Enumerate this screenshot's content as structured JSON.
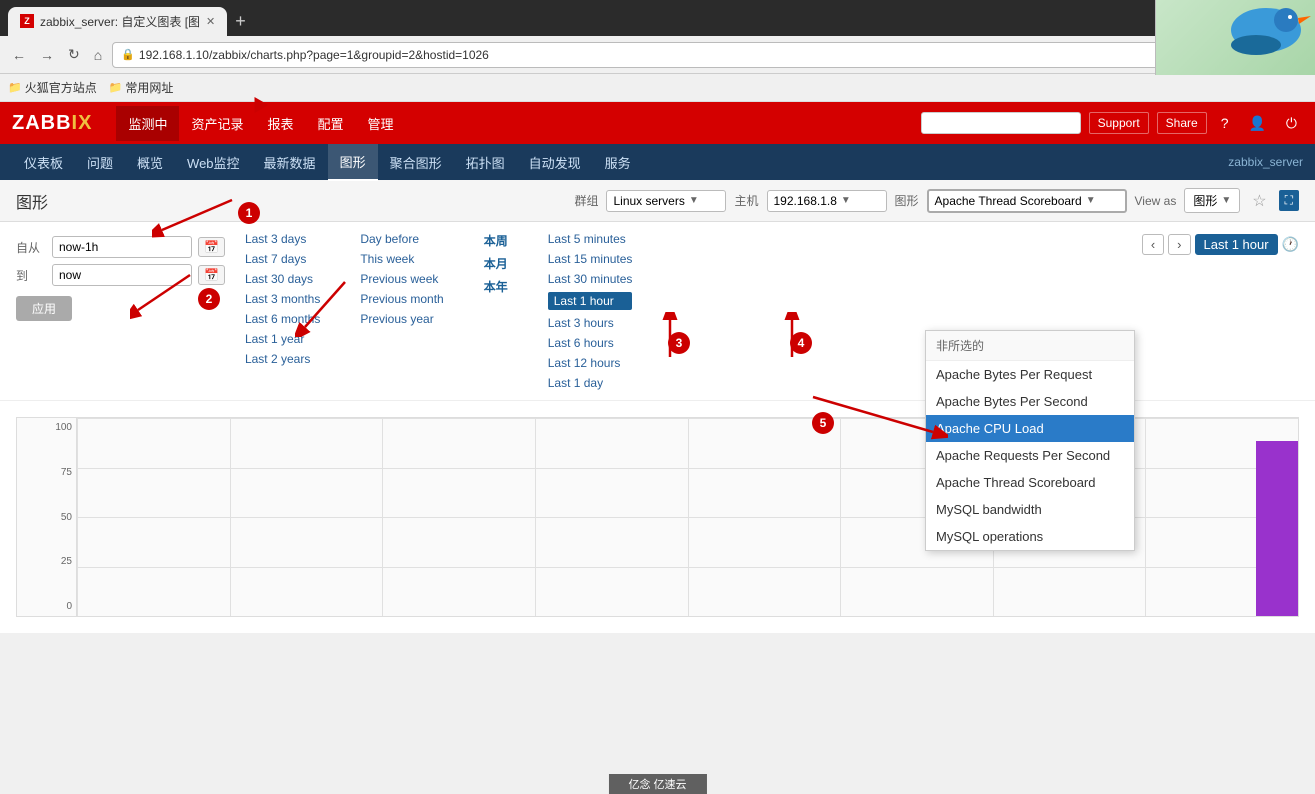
{
  "browser": {
    "tab_title": "zabbix_server: 自定义图表 [图",
    "tab_favicon": "Z",
    "url": "192.168.1.10/zabbix/charts.php?page=1&groupid=2&hostid=1026",
    "bookmark1_label": "火狐官方站点",
    "bookmark2_label": "常用网址",
    "new_tab_label": "+"
  },
  "zabbix": {
    "logo": "ZABBIX",
    "nav": {
      "monitoring": "监测中",
      "assets": "资产记录",
      "reports": "报表",
      "config": "配置",
      "admin": "管理"
    },
    "sub_nav": {
      "dashboard": "仪表板",
      "problems": "问题",
      "overview": "概览",
      "web": "Web监控",
      "latest": "最新数据",
      "graphs": "图形",
      "screens": "聚合图形",
      "maps": "拓扑图",
      "discovery": "自动发现",
      "services": "服务"
    },
    "sub_nav_right": "zabbix_server",
    "header_buttons": {
      "support": "Support",
      "share": "Share"
    }
  },
  "page": {
    "title": "图形",
    "group_label": "群组",
    "host_label": "主机",
    "graph_label": "图形",
    "view_as_label": "View as",
    "group_value": "Linux servers",
    "host_value": "192.168.1.8",
    "graph_value": "Apache Thread Scoreboard",
    "view_as_value": "图形"
  },
  "filter": {
    "from_label": "自从",
    "to_label": "到",
    "from_value": "now-1h",
    "to_value": "now",
    "apply_label": "应用"
  },
  "time_periods": {
    "col1": [
      {
        "label": "Last 3 days",
        "id": "last3days"
      },
      {
        "label": "Last 7 days",
        "id": "last7days"
      },
      {
        "label": "Last 30 days",
        "id": "last30days"
      },
      {
        "label": "Last 3 months",
        "id": "last3months"
      },
      {
        "label": "Last 6 months",
        "id": "last6months"
      },
      {
        "label": "Last 1 year",
        "id": "last1year"
      },
      {
        "label": "Last 2 years",
        "id": "last2years"
      }
    ],
    "col2": [
      {
        "label": "Day before",
        "id": "daybefore"
      },
      {
        "label": "This week",
        "id": "thisweek"
      },
      {
        "label": "Previous week",
        "id": "prevweek"
      },
      {
        "label": "Previous month",
        "id": "prevmonth"
      },
      {
        "label": "Previous year",
        "id": "prevyear"
      }
    ],
    "col3": [
      {
        "label": "本周",
        "id": "thisweekzh"
      },
      {
        "label": "本月",
        "id": "thismonthzh"
      },
      {
        "label": "本年",
        "id": "thisyearzh"
      }
    ],
    "col4": [
      {
        "label": "Last 5 minutes",
        "id": "last5min"
      },
      {
        "label": "Last 15 minutes",
        "id": "last15min"
      },
      {
        "label": "Last 30 minutes",
        "id": "last30min"
      },
      {
        "label": "Last 1 hour",
        "id": "last1hour"
      },
      {
        "label": "Last 3 hours",
        "id": "last3hours"
      },
      {
        "label": "Last 6 hours",
        "id": "last6hours"
      },
      {
        "label": "Last 12 hours",
        "id": "last12hours"
      },
      {
        "label": "Last 1 day",
        "id": "last1day"
      }
    ]
  },
  "period_nav": {
    "back_label": "‹",
    "forward_label": "›",
    "current_label": "Last 1 hour"
  },
  "dropdown": {
    "header": "非所选的",
    "items": [
      {
        "label": "Apache Bytes Per Request",
        "id": "abpr",
        "selected": false
      },
      {
        "label": "Apache Bytes Per Second",
        "id": "abps",
        "selected": false
      },
      {
        "label": "Apache CPU Load",
        "id": "acl",
        "selected": true
      },
      {
        "label": "Apache Requests Per Second",
        "id": "arps",
        "selected": false
      },
      {
        "label": "Apache Thread Scoreboard",
        "id": "ats",
        "selected": false
      },
      {
        "label": "MySQL bandwidth",
        "id": "mysqlbw",
        "selected": false
      },
      {
        "label": "MySQL operations",
        "id": "mysqlops",
        "selected": false
      }
    ]
  },
  "annotations": [
    {
      "id": "1",
      "top": "240",
      "left": "258"
    },
    {
      "id": "2",
      "top": "286",
      "left": "300"
    },
    {
      "id": "3",
      "top": "323",
      "left": "672"
    },
    {
      "id": "4",
      "top": "323",
      "left": "790"
    },
    {
      "id": "5",
      "top": "390",
      "left": "816"
    }
  ],
  "watermark": "亿念 亿速云"
}
